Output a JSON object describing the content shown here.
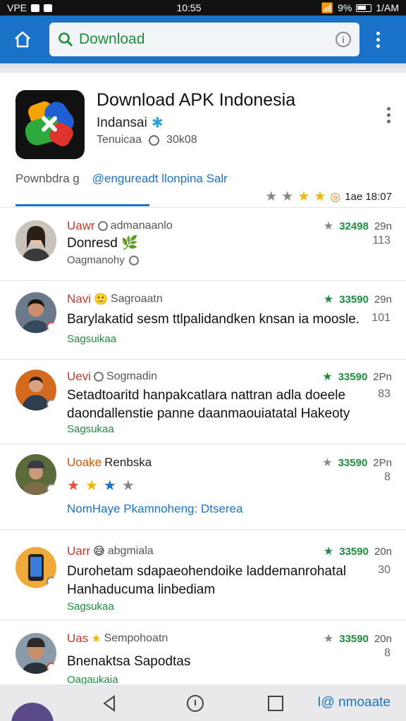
{
  "status_bar": {
    "carrier": "VPE",
    "time": "10:55",
    "battery": "9%",
    "clock_right": "1/AM"
  },
  "toolbar": {
    "search_value": "Download"
  },
  "app": {
    "title": "Download APK Indonesia",
    "developer": "Indansai",
    "category": "Tenuicaa",
    "downloads": "30k08",
    "tab_inactive": "Pownbdra g",
    "tab_active": "@engureadt llonpina Salr",
    "rating_date": "1ae 18:07"
  },
  "reviews": [
    {
      "name": "Uawr",
      "handle": "admanaanlo",
      "score": "32498",
      "time": "29n",
      "count": "113",
      "text": "Donresd",
      "foot": "Oagmanohy"
    },
    {
      "name": "Navi",
      "handle": "Sagroaatn",
      "score": "33590",
      "time": "29n",
      "count": "101",
      "text": "Barylakatid sesm ttlpalidandken knsan ia moosle.",
      "foot": "Sagsuikaa"
    },
    {
      "name": "Uevi",
      "handle": "Sogmadin",
      "score": "33590",
      "time": "2Pn",
      "count": "83",
      "text": "Setadtoaritd hanpakcatlara nattran adla doeele daondallenstie panne daanmaouiatatal Hakeoty",
      "foot": "Sagsukaa"
    },
    {
      "name": "Uoake",
      "handle": "Renbska",
      "score": "33590",
      "time": "2Pn",
      "count": "8",
      "text": "",
      "foot": "NomHaye Pkamnoheng: Dtserea"
    },
    {
      "name": "Uarr",
      "handle": "abgmiala",
      "score": "33590",
      "time": "20n",
      "count": "30",
      "text": "Durohetam  sdapaeohendoike laddemanrohatal Hanhaducuma linbediam",
      "foot": "Sagsukaa"
    },
    {
      "name": "Uas",
      "handle": "Sempohoatn",
      "score": "33590",
      "time": "20n",
      "count": "8",
      "text": "Bnenaktsa  Sapodtas",
      "foot": "Oagaukaia"
    }
  ],
  "bottom_nav": {
    "label": "I@ nmoaate"
  }
}
